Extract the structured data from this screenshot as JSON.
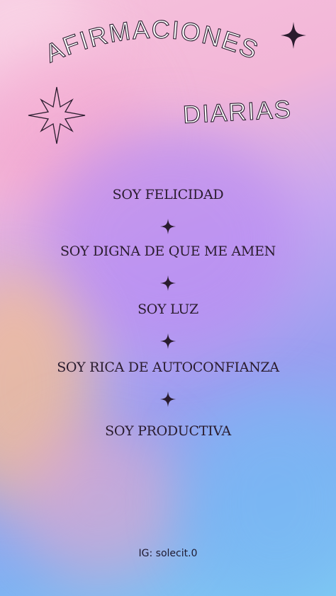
{
  "poster": {
    "title_line1": "AFIRMACIONES",
    "title_line2": "DIARIAS",
    "affirmations": [
      "SOY FELICIDAD",
      "SOY DIGNA DE QUE ME AMEN",
      "SOY LUZ",
      "SOY RICA DE AUTOCONFIANZA",
      "SOY PRODUCTIVA"
    ],
    "footer": "IG: solecit.0"
  },
  "icons": {
    "separator": "four-point-star-icon",
    "top_right": "four-point-star-icon",
    "left": "eight-point-starburst-icon"
  },
  "colors": {
    "text": "#2a1c2e",
    "gradient_pink": "#f2b6d8",
    "gradient_purple": "#c7a7f0",
    "gradient_blue": "#7ecbf2"
  }
}
